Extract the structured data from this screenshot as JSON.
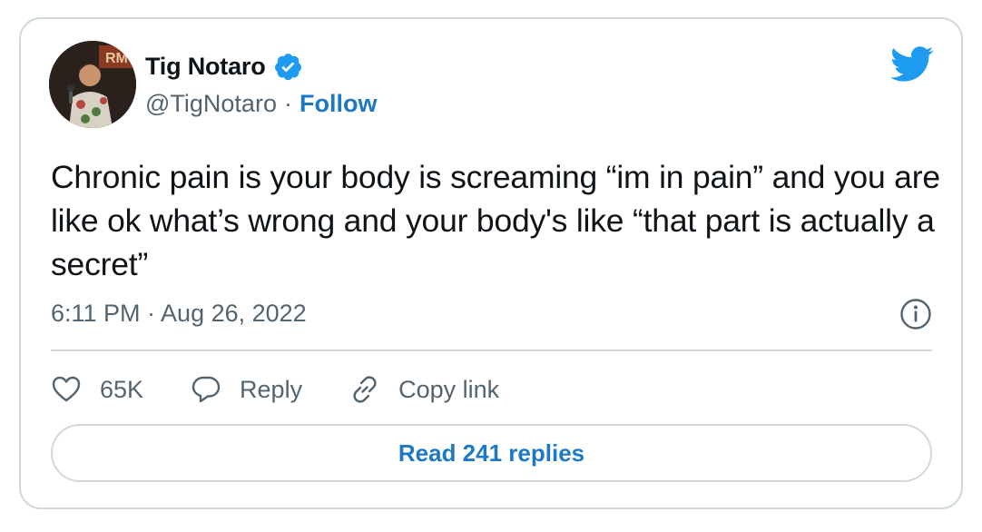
{
  "author": {
    "name": "Tig Notaro",
    "handle": "@TigNotaro",
    "separator": "·",
    "follow_label": "Follow",
    "verified": true
  },
  "tweet": {
    "text": "Chronic pain is your body is screaming “im in pain” and you are like ok what’s wrong and your body's like “that part is actually a secret”",
    "timestamp": "6:11 PM · Aug 26, 2022"
  },
  "actions": {
    "likes": "65K",
    "reply_label": "Reply",
    "copy_link_label": "Copy link"
  },
  "read_replies_label": "Read 241 replies",
  "colors": {
    "accent": "#1d79c4",
    "twitter_blue": "#1d9bf0",
    "muted": "#536471",
    "border": "#cfd9de"
  },
  "icons": [
    "verified-badge-icon",
    "twitter-bird-icon",
    "info-icon",
    "heart-icon",
    "reply-bubble-icon",
    "link-icon"
  ]
}
